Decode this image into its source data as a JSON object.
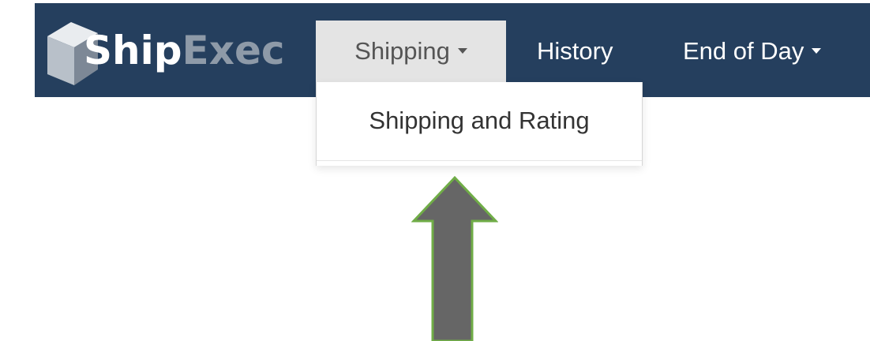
{
  "colors": {
    "navbar_bg": "#253f5e",
    "active_tab_bg": "#e4e4e4",
    "brand_ship": "#ffffff",
    "brand_exec": "#8e9aa8",
    "arrow_fill": "#666666",
    "arrow_outline": "#70ad47"
  },
  "brand": {
    "logo_icon": "cube-icon",
    "name_part1": "Ship",
    "name_part2": "Exec"
  },
  "nav": {
    "shipping_label": "Shipping",
    "history_label": "History",
    "end_of_day_label": "End of Day"
  },
  "dropdown": {
    "items": [
      {
        "label": "Shipping and Rating"
      }
    ]
  },
  "annotation": {
    "icon": "up-arrow-icon"
  }
}
